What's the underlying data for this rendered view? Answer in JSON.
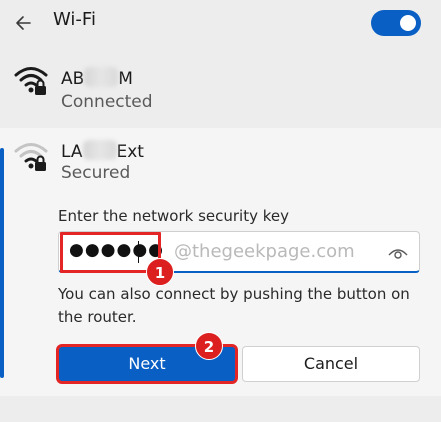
{
  "header": {
    "title": "Wi-Fi",
    "toggle_on": true,
    "accent": "#0a5fc4"
  },
  "networks": [
    {
      "name_prefix": "AB",
      "name_suffix": "M",
      "status": "Connected",
      "icon": "wifi-lock-icon"
    },
    {
      "name_prefix": "LA",
      "name_suffix": "Ext",
      "status": "Secured",
      "icon": "wifi-lock-icon"
    }
  ],
  "password_prompt": {
    "label": "Enter the network security key",
    "masked_value": "●●●●●●",
    "hint": "You can also connect by pushing the button on the router.",
    "next_label": "Next",
    "cancel_label": "Cancel"
  },
  "annotations": {
    "watermark": "@thegeekpage.com",
    "step1": "1",
    "step2": "2",
    "highlight_color": "#e32526"
  }
}
